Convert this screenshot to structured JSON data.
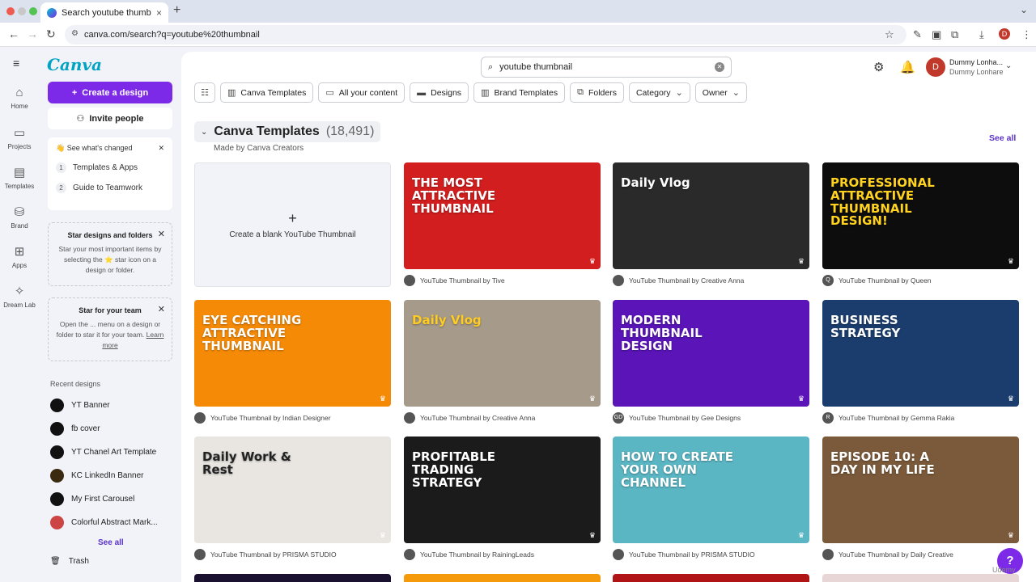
{
  "browser": {
    "tab_title": "Search youtube thumbnail - C",
    "url": "canva.com/search?q=youtube%20thumbnail",
    "profile_initial": "D"
  },
  "rail": [
    {
      "label": "Home",
      "icon": "home-icon"
    },
    {
      "label": "Projects",
      "icon": "folder-icon"
    },
    {
      "label": "Templates",
      "icon": "templates-icon"
    },
    {
      "label": "Brand",
      "icon": "brand-icon"
    },
    {
      "label": "Apps",
      "icon": "apps-icon"
    },
    {
      "label": "Dream Lab",
      "icon": "dreamlab-icon"
    }
  ],
  "sidebar": {
    "logo": "Canva",
    "create_label": "Create a design",
    "invite_label": "Invite people",
    "changes": {
      "title": "👋 See what's changed",
      "items": [
        {
          "n": "1",
          "label": "Templates & Apps"
        },
        {
          "n": "2",
          "label": "Guide to Teamwork"
        }
      ]
    },
    "star_designs": {
      "title": "Star designs and folders",
      "body": "Star your most important items by selecting the ⭐ star icon on a design or folder."
    },
    "star_team": {
      "title": "Star for your team",
      "body": "Open the ... menu on a design or folder to star it for your team.",
      "link": "Learn more"
    },
    "recent_heading": "Recent designs",
    "recent": [
      {
        "label": "YT Banner"
      },
      {
        "label": "fb cover"
      },
      {
        "label": "YT Chanel Art Template"
      },
      {
        "label": "KC LinkedIn Banner"
      },
      {
        "label": "My First Carousel"
      },
      {
        "label": "Colorful Abstract Mark..."
      }
    ],
    "see_all": "See all",
    "trash": "Trash"
  },
  "header": {
    "search_value": "youtube thumbnail",
    "user_name": "Dummy Lonha...",
    "user_sub": "Dummy Lonhare",
    "avatar_initial": "D"
  },
  "filters": [
    {
      "label": "Canva Templates",
      "icon": "template-icon"
    },
    {
      "label": "All your content",
      "icon": "folder-icon"
    },
    {
      "label": "Designs",
      "icon": "design-icon"
    },
    {
      "label": "Brand Templates",
      "icon": "brand-template-icon"
    },
    {
      "label": "Folders",
      "icon": "folders-icon"
    },
    {
      "label": "Category",
      "icon": "chevron-down-icon"
    },
    {
      "label": "Owner",
      "icon": "chevron-down-icon"
    }
  ],
  "section": {
    "title": "Canva Templates",
    "count": "(18,491)",
    "subtitle": "Made by Canva Creators",
    "see_all": "See all",
    "blank_label": "Create a blank YouTube Thumbnail"
  },
  "templates": [
    {
      "caption": "YouTube Thumbnail by Tive",
      "overlay": "THE MOST ATTRACTIVE THUMBNAIL",
      "bg": "#d21e1e",
      "au": "",
      "fg": "#ffffff"
    },
    {
      "caption": "YouTube Thumbnail by Creative Anna",
      "overlay": "Daily Vlog",
      "bg": "#2a2a2a",
      "au": "",
      "fg": "#ffffff"
    },
    {
      "caption": "YouTube Thumbnail by Queen",
      "overlay": "PROFESSIONAL ATTRACTIVE THUMBNAIL DESIGN!",
      "bg": "#0d0d0d",
      "au": "Q",
      "fg": "#ffd21f"
    },
    {
      "caption": "YouTube Thumbnail by Indian Designer",
      "overlay": "EYE CATCHING ATTRACTIVE THUMBNAIL",
      "bg": "#f58a07",
      "au": "",
      "fg": "#ffffff"
    },
    {
      "caption": "YouTube Thumbnail by Creative Anna",
      "overlay": "Daily Vlog",
      "bg": "#a69a8a",
      "au": "",
      "fg": "#ffcc22"
    },
    {
      "caption": "YouTube Thumbnail by Gee Designs",
      "overlay": "MODERN THUMBNAIL DESIGN",
      "bg": "#5a14b8",
      "au": "GD",
      "fg": "#ffffff"
    },
    {
      "caption": "YouTube Thumbnail by Gemma Rakia",
      "overlay": "BUSINESS STRATEGY",
      "bg": "#1a3d6e",
      "au": "R",
      "fg": "#ffffff"
    },
    {
      "caption": "YouTube Thumbnail by PRISMA STUDIO",
      "overlay": "Daily Work & Rest",
      "bg": "#e9e6e1",
      "au": "",
      "fg": "#222222"
    },
    {
      "caption": "YouTube Thumbnail by RainingLeads",
      "overlay": "PROFITABLE TRADING STRATEGY",
      "bg": "#1b1b1b",
      "au": "",
      "fg": "#ffffff"
    },
    {
      "caption": "YouTube Thumbnail by PRISMA STUDIO",
      "overlay": "HOW TO CREATE YOUR OWN CHANNEL",
      "bg": "#5bb6c4",
      "au": "",
      "fg": "#ffffff"
    },
    {
      "caption": "YouTube Thumbnail by Daily Creative",
      "overlay": "EPISODE 10: A DAY IN MY LIFE",
      "bg": "#7a5a3a",
      "au": "",
      "fg": "#ffffff"
    }
  ],
  "help_label": "?",
  "watermark": "Udemy",
  "colors": {
    "accent": "#7d2ae8",
    "link": "#5a32c8"
  }
}
